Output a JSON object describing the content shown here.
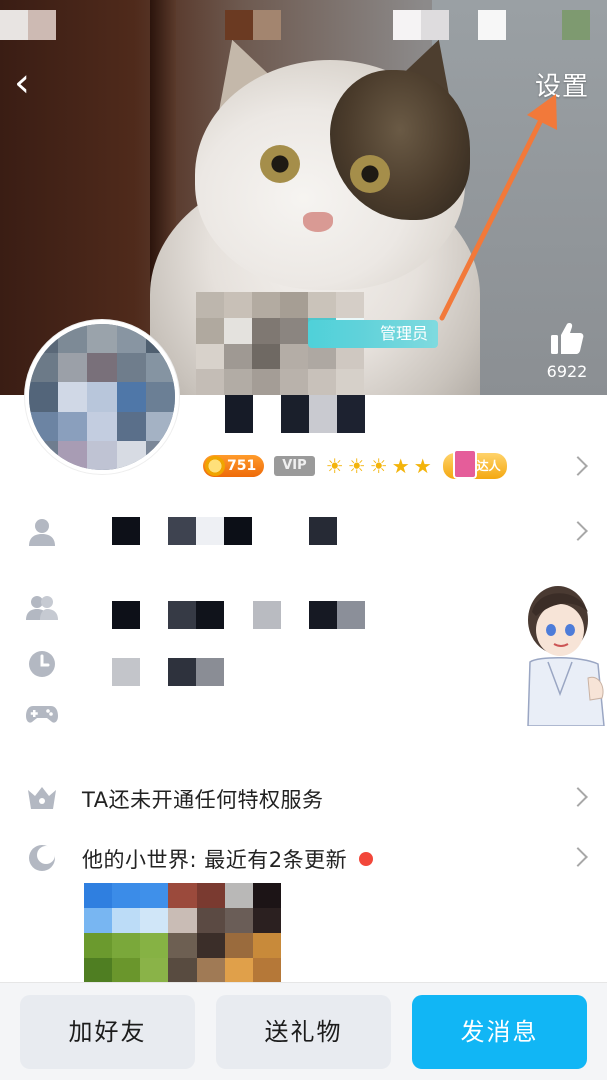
{
  "header": {
    "back_glyph": "‹",
    "settings_label": "设置",
    "admin_tag": "管理员"
  },
  "like": {
    "count": "6922",
    "icon": "thumbs-up-icon"
  },
  "badges": {
    "coin_value": "751",
    "vip_label": "VIP",
    "level_glyphs": [
      "☀",
      "☀",
      "☀",
      "★",
      "★"
    ],
    "daren_label": "达人"
  },
  "privilege": {
    "text": "TA还未开通任何特权服务",
    "icon": "crown-icon"
  },
  "world": {
    "text": "他的小世界: 最近有2条更新",
    "icon": "moon-icon",
    "has_unread": true
  },
  "actions": {
    "add_friend": "加好友",
    "send_gift": "送礼物",
    "send_message": "发消息"
  },
  "colors": {
    "accent": "#11B6F5",
    "admin_tag": "#4FD1D9",
    "annotation_arrow": "#F2793A",
    "unread_dot": "#F2473A",
    "icon_gray": "#B3B8C2"
  }
}
